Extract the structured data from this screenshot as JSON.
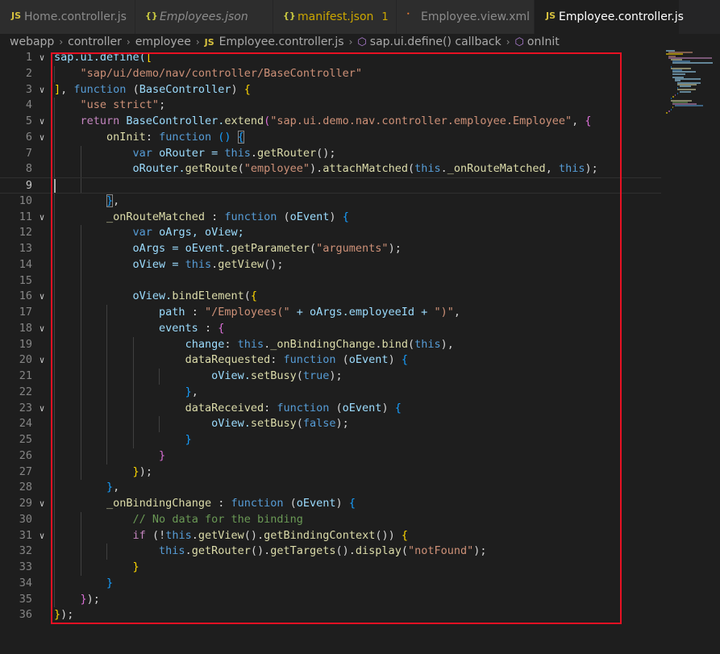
{
  "tabs": [
    {
      "label": "Home.controller.js",
      "icon": "js-file-icon",
      "type_badge": "JS",
      "style": "normal"
    },
    {
      "label": "Employees.json",
      "icon": "json-file-icon",
      "type_badge": "{}",
      "style": "italic"
    },
    {
      "label": "manifest.json",
      "icon": "json-file-icon",
      "type_badge": "{}",
      "style": "warn",
      "problems": "1"
    },
    {
      "label": "Employee.view.xml",
      "icon": "rss-xml-file-icon",
      "type_badge": "ॱ",
      "style": "normal"
    },
    {
      "label": "Employee.controller.js",
      "icon": "js-file-icon",
      "type_badge": "JS",
      "style": "active",
      "modified": true
    }
  ],
  "breadcrumb": {
    "items": [
      "webapp",
      "controller",
      "employee"
    ],
    "file_badge": "JS",
    "file": "Employee.controller.js",
    "symbol1": "sap.ui.define() callback",
    "symbol2": "onInit"
  },
  "editor": {
    "current_line": 9,
    "lines": [
      {
        "n": "1",
        "fold": "v",
        "t": [
          [
            "sap.ui.define(",
            "id"
          ],
          [
            "[",
            "b1"
          ]
        ]
      },
      {
        "n": "2",
        "t": [
          [
            "    ",
            ""
          ],
          [
            "\"sap/ui/demo/nav/controller/BaseController\"",
            "str"
          ]
        ]
      },
      {
        "n": "3",
        "fold": "v",
        "t": [
          [
            "]",
            "b1"
          ],
          [
            ", ",
            "p"
          ],
          [
            "function",
            "kw"
          ],
          [
            " (",
            "p"
          ],
          [
            "BaseController",
            "par"
          ],
          [
            ") ",
            "p"
          ],
          [
            "{",
            "b1"
          ]
        ]
      },
      {
        "n": "4",
        "t": [
          [
            "    ",
            ""
          ],
          [
            "\"use strict\"",
            "str"
          ],
          [
            ";",
            "p"
          ]
        ]
      },
      {
        "n": "5",
        "fold": "v",
        "t": [
          [
            "    ",
            ""
          ],
          [
            "return",
            "ctl"
          ],
          [
            " BaseController.",
            "id"
          ],
          [
            "extend",
            "fn"
          ],
          [
            "(",
            "b2"
          ],
          [
            "\"sap.ui.demo.nav.controller.employee.Employee\"",
            "str"
          ],
          [
            ", ",
            "p"
          ],
          [
            "{",
            "b2"
          ]
        ]
      },
      {
        "n": "6",
        "fold": "v",
        "t": [
          [
            "        ",
            ""
          ],
          [
            "onInit",
            "fn"
          ],
          [
            ": ",
            "p"
          ],
          [
            "function",
            "kw"
          ],
          [
            " () ",
            "b3"
          ],
          [
            "{",
            "b3box"
          ]
        ]
      },
      {
        "n": "7",
        "t": [
          [
            "            ",
            ""
          ],
          [
            "var",
            "kw"
          ],
          [
            " oRouter = ",
            "id"
          ],
          [
            "this",
            "kw"
          ],
          [
            ".",
            "p"
          ],
          [
            "getRouter",
            "fn"
          ],
          [
            "();",
            "p"
          ]
        ]
      },
      {
        "n": "8",
        "t": [
          [
            "            ",
            ""
          ],
          [
            "oRouter.",
            "id"
          ],
          [
            "getRoute",
            "fn"
          ],
          [
            "(",
            "p"
          ],
          [
            "\"employee\"",
            "str"
          ],
          [
            ").",
            "p"
          ],
          [
            "attachMatched",
            "fn"
          ],
          [
            "(",
            "p"
          ],
          [
            "this",
            "kw"
          ],
          [
            ".",
            "p"
          ],
          [
            "_onRouteMatched",
            "fn"
          ],
          [
            ", ",
            "p"
          ],
          [
            "this",
            "kw"
          ],
          [
            ");",
            "p"
          ]
        ]
      },
      {
        "n": "9",
        "t": []
      },
      {
        "n": "10",
        "t": [
          [
            "        ",
            ""
          ],
          [
            "}",
            "b3box"
          ],
          [
            ",",
            "p"
          ]
        ]
      },
      {
        "n": "11",
        "fold": "v",
        "t": [
          [
            "        ",
            ""
          ],
          [
            "_onRouteMatched",
            "fn"
          ],
          [
            " : ",
            "p"
          ],
          [
            "function",
            "kw"
          ],
          [
            " (",
            "p"
          ],
          [
            "oEvent",
            "par"
          ],
          [
            ") ",
            "p"
          ],
          [
            "{",
            "b3"
          ]
        ]
      },
      {
        "n": "12",
        "t": [
          [
            "            ",
            ""
          ],
          [
            "var",
            "kw"
          ],
          [
            " oArgs, oView;",
            "id"
          ]
        ]
      },
      {
        "n": "13",
        "t": [
          [
            "            ",
            ""
          ],
          [
            "oArgs = oEvent.",
            "id"
          ],
          [
            "getParameter",
            "fn"
          ],
          [
            "(",
            "p"
          ],
          [
            "\"arguments\"",
            "str"
          ],
          [
            ");",
            "p"
          ]
        ]
      },
      {
        "n": "14",
        "t": [
          [
            "            ",
            ""
          ],
          [
            "oView = ",
            "id"
          ],
          [
            "this",
            "kw"
          ],
          [
            ".",
            "p"
          ],
          [
            "getView",
            "fn"
          ],
          [
            "();",
            "p"
          ]
        ]
      },
      {
        "n": "15",
        "t": []
      },
      {
        "n": "16",
        "fold": "v",
        "t": [
          [
            "            ",
            ""
          ],
          [
            "oView.",
            "id"
          ],
          [
            "bindElement",
            "fn"
          ],
          [
            "(",
            "p"
          ],
          [
            "{",
            "b1"
          ]
        ]
      },
      {
        "n": "17",
        "t": [
          [
            "                ",
            ""
          ],
          [
            "path",
            "id"
          ],
          [
            " : ",
            "p"
          ],
          [
            "\"/Employees(\"",
            "str"
          ],
          [
            " + oArgs.employeeId + ",
            "id"
          ],
          [
            "\")\"",
            "str"
          ],
          [
            ",",
            "p"
          ]
        ]
      },
      {
        "n": "18",
        "fold": "v",
        "t": [
          [
            "                ",
            ""
          ],
          [
            "events",
            "id"
          ],
          [
            " : ",
            "p"
          ],
          [
            "{",
            "b2"
          ]
        ]
      },
      {
        "n": "19",
        "t": [
          [
            "                    ",
            ""
          ],
          [
            "change",
            "id"
          ],
          [
            ": ",
            "p"
          ],
          [
            "this",
            "kw"
          ],
          [
            ".",
            "p"
          ],
          [
            "_onBindingChange",
            "fn"
          ],
          [
            ".",
            "p"
          ],
          [
            "bind",
            "fn"
          ],
          [
            "(",
            "p"
          ],
          [
            "this",
            "kw"
          ],
          [
            "),",
            "p"
          ]
        ]
      },
      {
        "n": "20",
        "fold": "v",
        "t": [
          [
            "                    ",
            ""
          ],
          [
            "dataRequested",
            "fn"
          ],
          [
            ": ",
            "p"
          ],
          [
            "function",
            "kw"
          ],
          [
            " (",
            "p"
          ],
          [
            "oEvent",
            "par"
          ],
          [
            ") ",
            "p"
          ],
          [
            "{",
            "b3"
          ]
        ]
      },
      {
        "n": "21",
        "t": [
          [
            "                        ",
            ""
          ],
          [
            "oView.",
            "id"
          ],
          [
            "setBusy",
            "fn"
          ],
          [
            "(",
            "p"
          ],
          [
            "true",
            "kw"
          ],
          [
            ");",
            "p"
          ]
        ]
      },
      {
        "n": "22",
        "t": [
          [
            "                    ",
            ""
          ],
          [
            "}",
            "b3"
          ],
          [
            ",",
            "p"
          ]
        ]
      },
      {
        "n": "23",
        "fold": "v",
        "t": [
          [
            "                    ",
            ""
          ],
          [
            "dataReceived",
            "fn"
          ],
          [
            ": ",
            "p"
          ],
          [
            "function",
            "kw"
          ],
          [
            " (",
            "p"
          ],
          [
            "oEvent",
            "par"
          ],
          [
            ") ",
            "p"
          ],
          [
            "{",
            "b3"
          ]
        ]
      },
      {
        "n": "24",
        "t": [
          [
            "                        ",
            ""
          ],
          [
            "oView.",
            "id"
          ],
          [
            "setBusy",
            "fn"
          ],
          [
            "(",
            "p"
          ],
          [
            "false",
            "kw"
          ],
          [
            ");",
            "p"
          ]
        ]
      },
      {
        "n": "25",
        "t": [
          [
            "                    ",
            ""
          ],
          [
            "}",
            "b3"
          ]
        ]
      },
      {
        "n": "26",
        "t": [
          [
            "                ",
            ""
          ],
          [
            "}",
            "b2"
          ]
        ]
      },
      {
        "n": "27",
        "t": [
          [
            "            ",
            ""
          ],
          [
            "}",
            "b1"
          ],
          [
            ");",
            "p"
          ]
        ]
      },
      {
        "n": "28",
        "t": [
          [
            "        ",
            ""
          ],
          [
            "}",
            "b3"
          ],
          [
            ",",
            "p"
          ]
        ]
      },
      {
        "n": "29",
        "fold": "v",
        "t": [
          [
            "        ",
            ""
          ],
          [
            "_onBindingChange",
            "fn"
          ],
          [
            " : ",
            "p"
          ],
          [
            "function",
            "kw"
          ],
          [
            " (",
            "p"
          ],
          [
            "oEvent",
            "par"
          ],
          [
            ") ",
            "p"
          ],
          [
            "{",
            "b3"
          ]
        ]
      },
      {
        "n": "30",
        "t": [
          [
            "            ",
            ""
          ],
          [
            "// No data for the binding",
            "cm"
          ]
        ]
      },
      {
        "n": "31",
        "fold": "v",
        "t": [
          [
            "            ",
            ""
          ],
          [
            "if",
            "ctl"
          ],
          [
            " (!",
            "p"
          ],
          [
            "this",
            "kw"
          ],
          [
            ".",
            "p"
          ],
          [
            "getView",
            "fn"
          ],
          [
            "().",
            "p"
          ],
          [
            "getBindingContext",
            "fn"
          ],
          [
            "()) ",
            "p"
          ],
          [
            "{",
            "b1"
          ]
        ]
      },
      {
        "n": "32",
        "t": [
          [
            "                ",
            ""
          ],
          [
            "this",
            "kw"
          ],
          [
            ".",
            "p"
          ],
          [
            "getRouter",
            "fn"
          ],
          [
            "().",
            "p"
          ],
          [
            "getTargets",
            "fn"
          ],
          [
            "().",
            "p"
          ],
          [
            "display",
            "fn"
          ],
          [
            "(",
            "p"
          ],
          [
            "\"notFound\"",
            "str"
          ],
          [
            ");",
            "p"
          ]
        ]
      },
      {
        "n": "33",
        "t": [
          [
            "            ",
            ""
          ],
          [
            "}",
            "b1"
          ]
        ]
      },
      {
        "n": "34",
        "t": [
          [
            "        ",
            ""
          ],
          [
            "}",
            "b3"
          ]
        ]
      },
      {
        "n": "35",
        "t": [
          [
            "    ",
            ""
          ],
          [
            "}",
            "b2"
          ],
          [
            ");",
            "p"
          ]
        ]
      },
      {
        "n": "36",
        "t": [
          [
            "}",
            "b1"
          ],
          [
            ");",
            "p"
          ]
        ]
      }
    ]
  },
  "colors": {
    "id": "#9cdcfe",
    "kw": "#569cd6",
    "ctl": "#c586c0",
    "fn": "#dcdcaa",
    "str": "#ce9178",
    "cm": "#6a9955",
    "par": "#9cdcfe",
    "p": "#d4d4d4",
    "b1": "#ffd700",
    "b2": "#da70d6",
    "b3": "#179fff",
    "b3box": "#179fff",
    "highlight": "#e81123"
  }
}
